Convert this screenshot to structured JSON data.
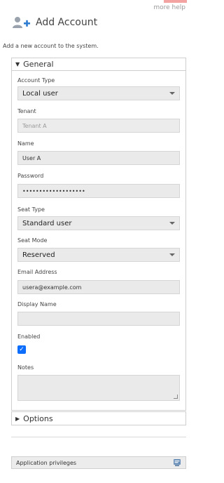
{
  "links": {
    "more_help": "more help"
  },
  "header": {
    "title": "Add Account",
    "icon": "add-user-icon"
  },
  "subtitle": "Add a new account to the system.",
  "general": {
    "title": "General",
    "fields": {
      "account_type": {
        "label": "Account Type",
        "value": "Local user"
      },
      "tenant": {
        "label": "Tenant",
        "value": "Tenant A"
      },
      "name": {
        "label": "Name",
        "value": "User A"
      },
      "password": {
        "label": "Password",
        "value": "•••••••••••••••••••"
      },
      "seat_type": {
        "label": "Seat Type",
        "value": "Standard user"
      },
      "seat_mode": {
        "label": "Seat Mode",
        "value": "Reserved"
      },
      "email": {
        "label": "Email Address",
        "value": "usera@example.com"
      },
      "display_name": {
        "label": "Display Name",
        "value": ""
      },
      "enabled": {
        "label": "Enabled",
        "checked": true
      },
      "notes": {
        "label": "Notes",
        "value": ""
      }
    }
  },
  "options": {
    "title": "Options"
  },
  "app_privileges": {
    "label": "Application privileges",
    "icon": "privileges-icon"
  },
  "colors": {
    "accent": "#0d6efd",
    "top_accent": "#f4a3a3",
    "field_bg": "#eaeaea"
  }
}
